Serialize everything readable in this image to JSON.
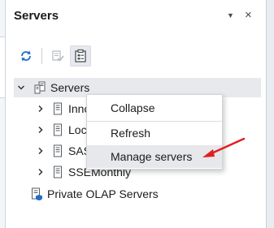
{
  "pane": {
    "title": "Servers",
    "menu_glyph": "▼",
    "close_glyph": "×"
  },
  "toolbar": {
    "buttons": [
      {
        "icon": "refresh-icon",
        "enabled": true
      },
      {
        "icon": "check-doc-icon",
        "enabled": false
      },
      {
        "icon": "clipboard-properties-icon",
        "enabled": true,
        "active": true
      }
    ]
  },
  "tree": {
    "root": {
      "label": "Servers",
      "icon": "server-group-icon",
      "expanded": true
    },
    "children": [
      {
        "label": "Inno",
        "icon": "server-icon"
      },
      {
        "label": "Loc",
        "icon": "server-icon"
      },
      {
        "label": "SAS",
        "icon": "server-icon"
      },
      {
        "label": "SSEMonthly",
        "icon": "server-icon"
      }
    ],
    "other": {
      "label": "Private OLAP Servers",
      "icon": "olap-server-icon"
    }
  },
  "context_menu": {
    "items": [
      {
        "label": "Collapse"
      },
      {
        "label": "Refresh"
      },
      {
        "label": "Manage servers"
      }
    ]
  },
  "colors": {
    "accent": "#1e6fc5",
    "arrow": "#e02020",
    "selection": "#e7e9ec"
  }
}
